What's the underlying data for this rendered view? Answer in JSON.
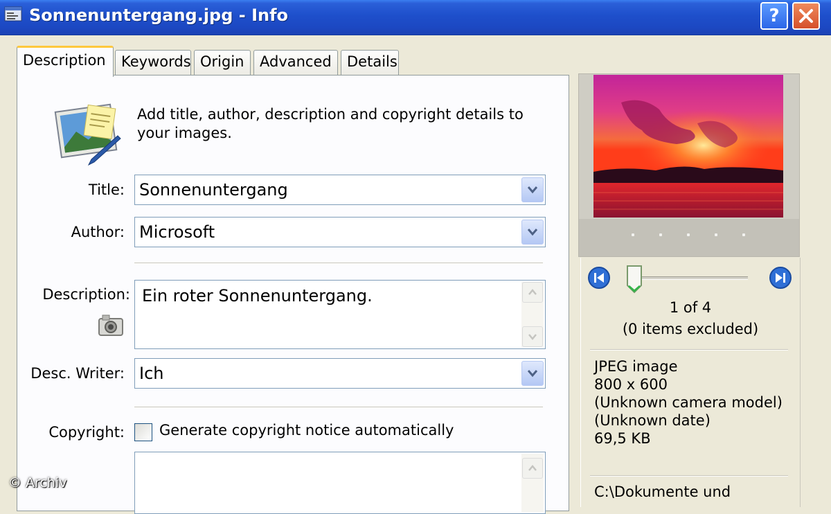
{
  "window": {
    "title": "Sonnenuntergang.jpg - Info",
    "help_label": "?",
    "close_label": "close",
    "titlebar_color": "#1e4fcb"
  },
  "tabs": [
    {
      "label": "Description",
      "active": true
    },
    {
      "label": "Keywords",
      "active": false
    },
    {
      "label": "Origin",
      "active": false
    },
    {
      "label": "Advanced",
      "active": false
    },
    {
      "label": "Details",
      "active": false
    }
  ],
  "description_tab": {
    "intro": "Add title, author, description and copyright details to your images.",
    "title": {
      "label": "Title:",
      "value": "Sonnenuntergang"
    },
    "author": {
      "label": "Author:",
      "value": "Microsoft"
    },
    "description": {
      "label": "Description:",
      "value": "Ein roter Sonnenuntergang."
    },
    "desc_writer": {
      "label": "Desc. Writer:",
      "value": "Ich"
    },
    "copyright": {
      "label": "Copyright:",
      "checkbox_label": "Generate copyright notice automatically",
      "checked": false,
      "value": ""
    }
  },
  "preview": {
    "position": "1 of 4",
    "excluded": "(0 items excluded)",
    "slider_fraction": 0.0
  },
  "file_info": {
    "type": "JPEG image",
    "dimensions": "800 x 600",
    "camera": "(Unknown camera model)",
    "date": "(Unknown date)",
    "size": "69,5 KB",
    "path": "C:\\Dokumente und"
  },
  "watermark": "© Archiv"
}
